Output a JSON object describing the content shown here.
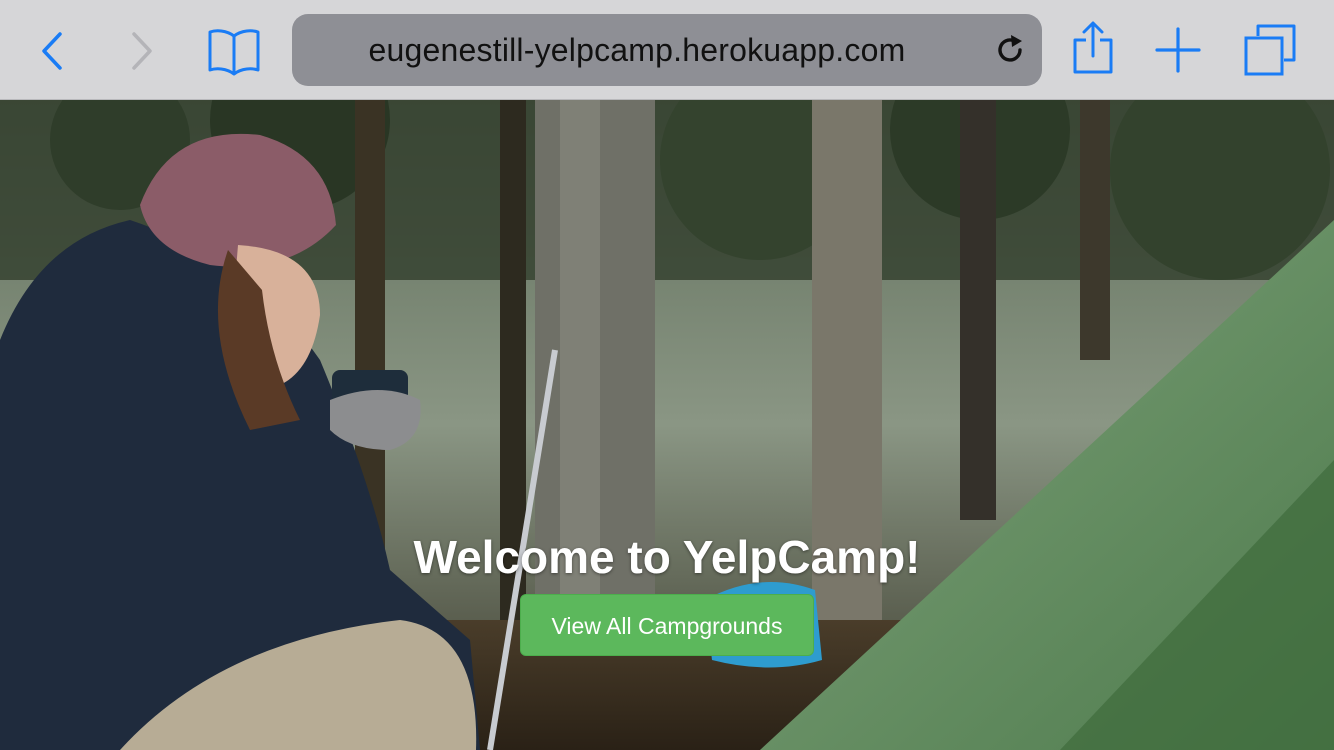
{
  "browser": {
    "url": "eugenestill-yelpcamp.herokuapp.com",
    "icons": {
      "back": "chevron-left-icon",
      "forward": "chevron-right-icon",
      "bookmarks": "book-icon",
      "reload": "reload-icon",
      "share": "share-icon",
      "new_tab": "plus-icon",
      "tabs": "tabs-icon"
    },
    "accent_color": "#1a7cf5",
    "disabled_color": "#b4b4b8"
  },
  "hero": {
    "title": "Welcome to YelpCamp!",
    "button_label": "View All Campgrounds",
    "button_color": "#5cb85c"
  }
}
